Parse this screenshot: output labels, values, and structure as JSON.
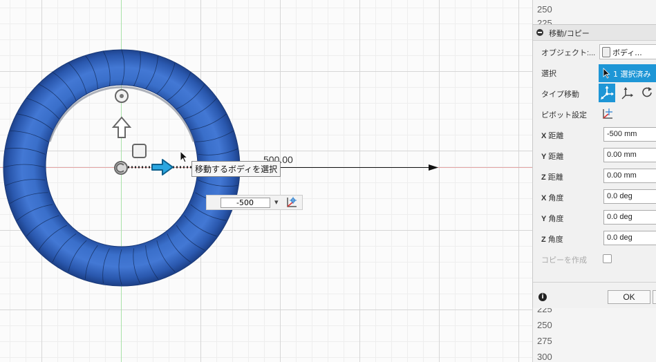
{
  "viewport": {
    "dimension_label": "500.00",
    "tooltip": "移動するボディを選択",
    "distance_input_value": "-500",
    "dropdown_glyph": "▾"
  },
  "ruler": {
    "top_ticks": [
      "250",
      "225"
    ],
    "bottom_ticks": [
      "225",
      "250",
      "275",
      "300"
    ]
  },
  "panel": {
    "title": "移動/コピー",
    "object_label": "オブジェクト:...",
    "object_value": "ボディ...",
    "selection_label": "選択",
    "selection_button": "1 選択済み",
    "type_label": "タイプ移動",
    "pivot_label": "ピボット設定",
    "fields": [
      {
        "axis": "X",
        "label": "距離",
        "value": "-500 mm"
      },
      {
        "axis": "Y",
        "label": "距離",
        "value": "0.00 mm"
      },
      {
        "axis": "Z",
        "label": "距離",
        "value": "0.00 mm"
      },
      {
        "axis": "X",
        "label": "角度",
        "value": "0.0 deg"
      },
      {
        "axis": "Y",
        "label": "角度",
        "value": "0.0 deg"
      },
      {
        "axis": "Z",
        "label": "角度",
        "value": "0.0 deg"
      }
    ],
    "copy_label": "コピーを作成",
    "ok_label": "OK",
    "info_glyph": "i"
  },
  "colors": {
    "accent": "#1e96d6",
    "tire": "#2e5fb5",
    "axis_red": "#e08b8b",
    "axis_green": "#8fd88f"
  }
}
